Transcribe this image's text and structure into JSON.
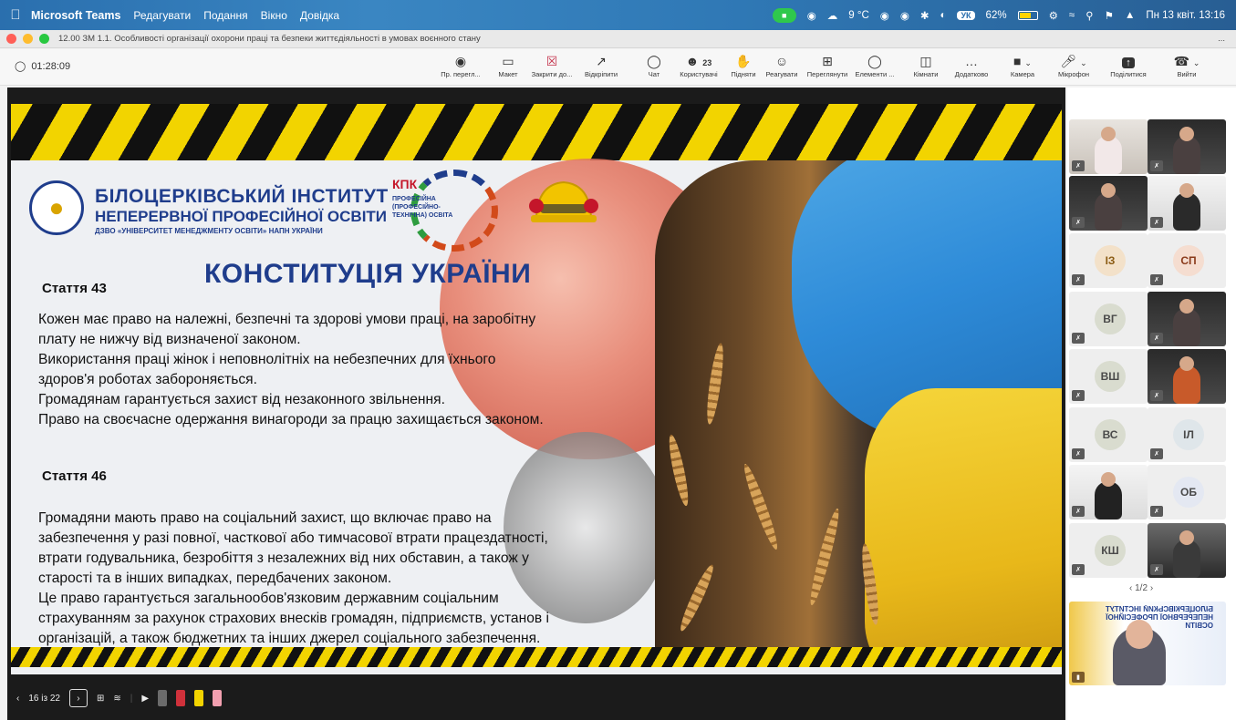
{
  "menubar": {
    "app_name": "Microsoft Teams",
    "menus": [
      "Редагувати",
      "Подання",
      "Вікно",
      "Довідка"
    ],
    "weather": "9 °C",
    "input_lang": "УК",
    "battery": "62%",
    "datetime": "Пн 13 квіт. 13:16"
  },
  "window": {
    "title": "12.00 ЗМ 1.1. Особливості організації охорони праці та безпеки життєдіяльності в умовах воєнного стану",
    "more": "..."
  },
  "toolbar": {
    "timer": "01:28:09",
    "buttons": [
      {
        "label": "Пр. перегл..."
      },
      {
        "label": "Макет"
      },
      {
        "label": "Закрити до..."
      },
      {
        "label": "Відкріпити"
      },
      {
        "label": "Чат"
      },
      {
        "label": "Користувачі",
        "count": "23"
      },
      {
        "label": "Підняти"
      },
      {
        "label": "Реагувати"
      },
      {
        "label": "Переглянути"
      },
      {
        "label": "Елементи ..."
      },
      {
        "label": "Кімнати"
      },
      {
        "label": "Додатково"
      },
      {
        "label": "Камера"
      },
      {
        "label": "Мікрофон"
      },
      {
        "label": "Поділитися"
      },
      {
        "label": "Вийти"
      }
    ]
  },
  "slide": {
    "institute_line1": "БІЛОЦЕРКІВСЬКИЙ ІНСТИТУТ",
    "institute_line2": "НЕПЕРЕРВНОЇ ПРОФЕСІЙНОЇ ОСВІТИ",
    "institute_line3": "ДЗВО «УНІВЕРСИТЕТ МЕНЕДЖМЕНТУ ОСВІТИ» НАПН УКРАЇНИ",
    "kpk": "КПК",
    "kpk_sub": "ПРОФЕСІЙНА (ПРОФЕСІЙНО-ТЕХНІЧНА) ОСВІТА",
    "heading": "КОНСТИТУЦІЯ УКРАЇНИ",
    "article1_title": "Стаття 43",
    "article1_text": [
      "Кожен має право на належні, безпечні та здорові умови праці, на заробітну",
      "плату не нижчу від визначеної законом.",
      "Використання праці жінок і неповнолітніх на небезпечних для їхнього",
      "здоров'я роботах забороняється.",
      "Громадянам гарантується захист від незаконного звільнення.",
      "Право на своєчасне одержання винагороди за працю захищається законом."
    ],
    "article2_title": "Стаття 46",
    "article2_text": [
      "Громадяни мають право на соціальний захист, що включає право на",
      "забезпечення у разі повної, часткової або тимчасової втрати працездатності,",
      "втрати годувальника, безробіття з незалежних від них обставин, а також у",
      "старості та в інших випадках, передбачених законом.",
      "Це право гарантується загальнообов'язковим державним соціальним",
      "страхуванням за рахунок страхових внесків громадян, підприємств, установ і",
      "організацій, а також бюджетних та інших джерел соціального забезпечення."
    ]
  },
  "slide_controls": {
    "page": "16 із 22"
  },
  "gallery": {
    "avatars": [
      "ІЗ",
      "СП",
      "ВГ",
      "ВШ",
      "ВС",
      "ІЛ",
      "ОБ",
      "КШ"
    ],
    "pager": "1/2"
  },
  "presenter": {
    "banner": "БІЛОЦЕРКІВСЬКИЙ ІНСТИТУТ НЕПЕРЕРВНОЇ ПРОФЕСІЙНОЇ ОСВІТИ"
  },
  "colors": {
    "brand_blue": "#1f3d8c",
    "hazard_yellow": "#f2d400",
    "leave_red": "#c4314b"
  }
}
